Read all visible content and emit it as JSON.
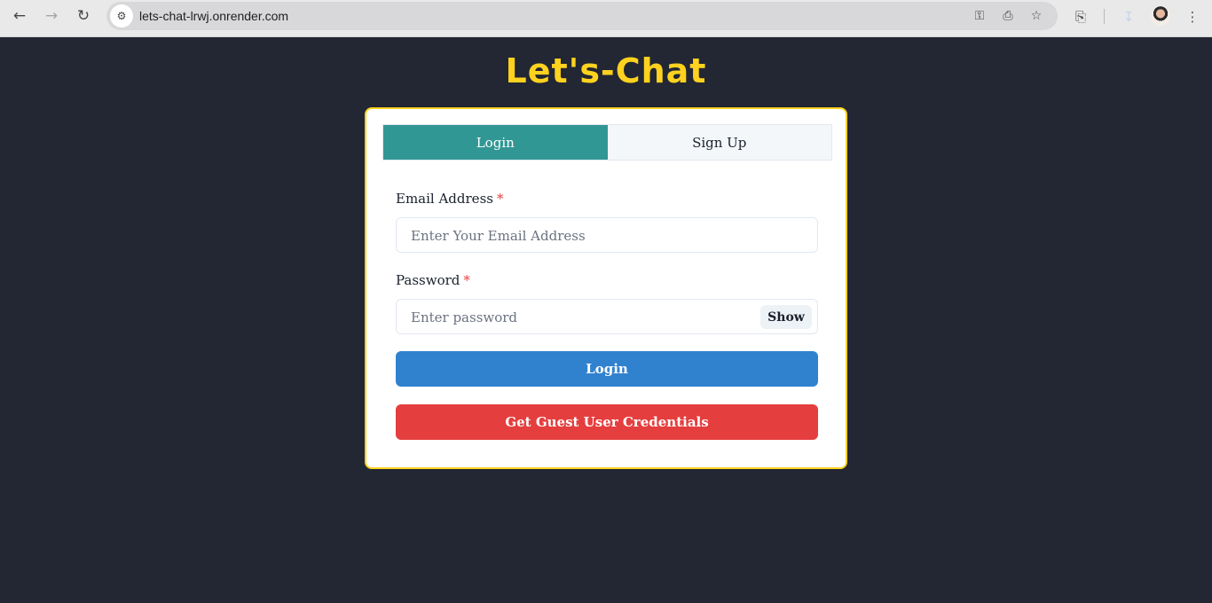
{
  "browser": {
    "url": "lets-chat-lrwj.onrender.com",
    "icons": {
      "back": "arrow-left-icon",
      "forward": "arrow-right-icon",
      "reload": "reload-icon",
      "site_info": "tune-icon",
      "password": "key-icon",
      "install": "install-app-icon",
      "bookmark": "star-icon",
      "extensions": "puzzle-icon",
      "download": "download-icon",
      "menu": "kebab-menu-icon"
    }
  },
  "app": {
    "title": "Let's-Chat",
    "tabs": [
      {
        "label": "Login",
        "active": true
      },
      {
        "label": "Sign Up",
        "active": false
      }
    ],
    "email": {
      "label": "Email Address",
      "required_mark": "*",
      "placeholder": "Enter Your Email Address",
      "value": ""
    },
    "password": {
      "label": "Password",
      "required_mark": "*",
      "placeholder": "Enter password",
      "value": "",
      "toggle_label": "Show"
    },
    "login_button": "Login",
    "guest_button": "Get Guest User Credentials"
  },
  "colors": {
    "page_background": "#222733",
    "title_yellow": "#ffd21f",
    "tab_active": "#319795",
    "login_blue": "#3182ce",
    "guest_red": "#e53e3e"
  }
}
